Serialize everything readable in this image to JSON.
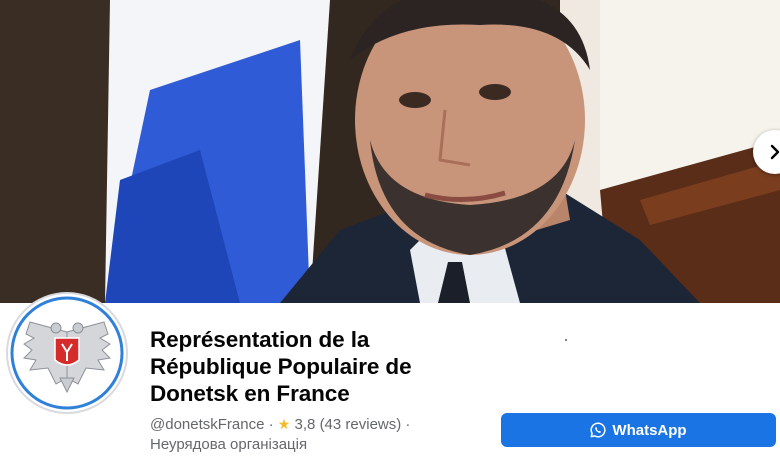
{
  "page": {
    "name": "Représentation de la République Populaire de Donetsk en France",
    "handle": "@donetskFrance",
    "separator": "·",
    "rating": "3,8",
    "reviews": "(43 reviews)",
    "category": "Неурядова організація"
  },
  "actions": {
    "whatsapp_label": "WhatsApp"
  },
  "icons": {
    "next": "chevron-right-icon",
    "star": "star-icon",
    "whatsapp": "whatsapp-icon"
  },
  "colors": {
    "button_blue": "#1b74e4",
    "star_yellow": "#f7b928",
    "meta_gray": "#65676b",
    "title_black": "#050505"
  }
}
